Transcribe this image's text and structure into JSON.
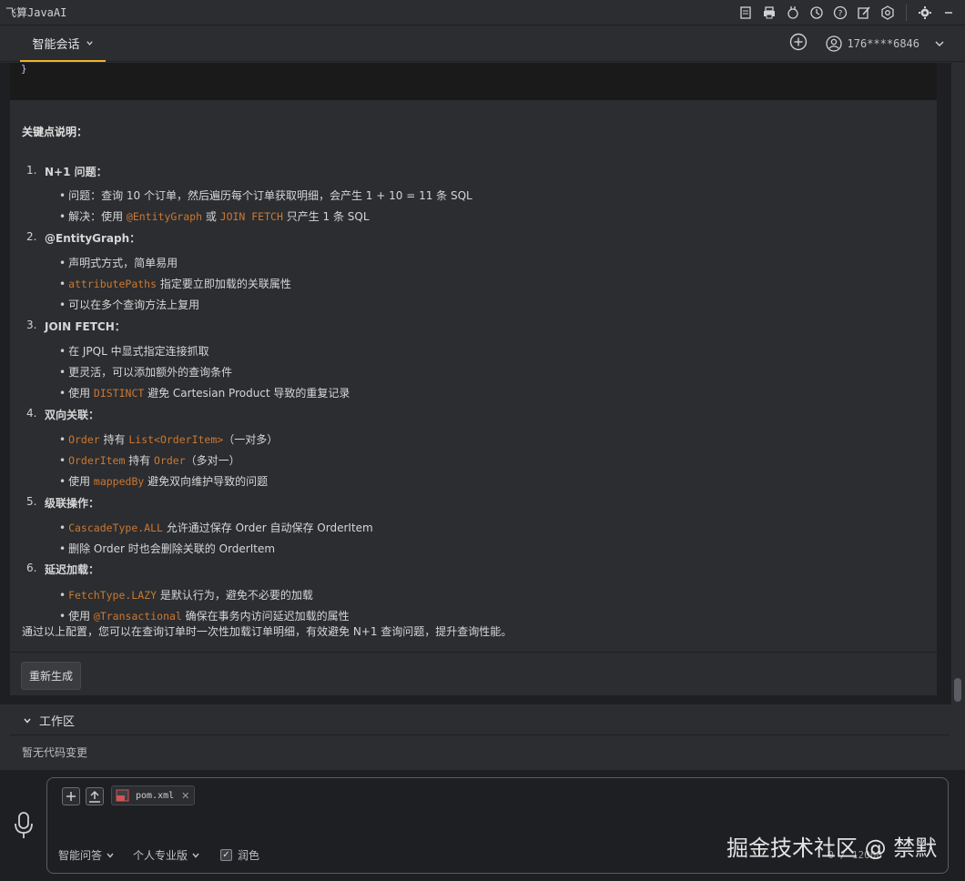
{
  "app": {
    "title": "飞算JavaAI"
  },
  "header": {
    "tab_label": "智能会话",
    "user_label": "176****6846"
  },
  "code_tail": "}",
  "answer": {
    "title": "关键点说明：",
    "sections": [
      {
        "num": "1.",
        "title": "N+1 问题：",
        "items": [
          {
            "parts": [
              {
                "t": "问题：查询 10 个订单，然后遍历每个订单获取明细，会产生 1 + 10 = 11 条 SQL"
              }
            ]
          },
          {
            "parts": [
              {
                "t": "解决：使用 "
              },
              {
                "c": "@EntityGraph"
              },
              {
                "t": " 或 "
              },
              {
                "c": "JOIN FETCH"
              },
              {
                "t": " 只产生 1 条 SQL"
              }
            ]
          }
        ]
      },
      {
        "num": "2.",
        "title": "@EntityGraph：",
        "items": [
          {
            "parts": [
              {
                "t": "声明式方式，简单易用"
              }
            ]
          },
          {
            "parts": [
              {
                "c": "attributePaths"
              },
              {
                "t": " 指定要立即加载的关联属性"
              }
            ]
          },
          {
            "parts": [
              {
                "t": "可以在多个查询方法上复用"
              }
            ]
          }
        ]
      },
      {
        "num": "3.",
        "title": "JOIN FETCH：",
        "items": [
          {
            "parts": [
              {
                "t": "在 JPQL 中显式指定连接抓取"
              }
            ]
          },
          {
            "parts": [
              {
                "t": "更灵活，可以添加额外的查询条件"
              }
            ]
          },
          {
            "parts": [
              {
                "t": "使用 "
              },
              {
                "c": "DISTINCT"
              },
              {
                "t": " 避免 Cartesian Product 导致的重复记录"
              }
            ]
          }
        ]
      },
      {
        "num": "4.",
        "title": "双向关联：",
        "items": [
          {
            "parts": [
              {
                "c": "Order"
              },
              {
                "t": " 持有 "
              },
              {
                "c": "List<OrderItem>"
              },
              {
                "t": "（一对多）"
              }
            ]
          },
          {
            "parts": [
              {
                "c": "OrderItem"
              },
              {
                "t": " 持有 "
              },
              {
                "c": "Order"
              },
              {
                "t": "（多对一）"
              }
            ]
          },
          {
            "parts": [
              {
                "t": "使用 "
              },
              {
                "c": "mappedBy"
              },
              {
                "t": " 避免双向维护导致的问题"
              }
            ]
          }
        ]
      },
      {
        "num": "5.",
        "title": "级联操作：",
        "items": [
          {
            "parts": [
              {
                "c": "CascadeType.ALL"
              },
              {
                "t": " 允许通过保存 Order 自动保存 OrderItem"
              }
            ]
          },
          {
            "parts": [
              {
                "t": "删除 Order 时也会删除关联的 OrderItem"
              }
            ]
          }
        ]
      },
      {
        "num": "6.",
        "title": "延迟加载：",
        "items": [
          {
            "parts": [
              {
                "c": "FetchType.LAZY"
              },
              {
                "t": " 是默认行为，避免不必要的加载"
              }
            ]
          },
          {
            "parts": [
              {
                "t": "使用 "
              },
              {
                "c": "@Transactional"
              },
              {
                "t": " 确保在事务内访问延迟加载的属性"
              }
            ]
          }
        ]
      }
    ],
    "conclusion": "通过以上配置，您可以在查询订单时一次性加载订单明细，有效避免 N+1 查询问题，提升查询性能。",
    "regen_label": "重新生成"
  },
  "workspace": {
    "title": "工作区",
    "empty_text": "暂无代码变更"
  },
  "input": {
    "attachment": "pom.xml",
    "mode": "智能问答",
    "edition": "个人专业版",
    "polish_label": "润色",
    "polish_checked": true,
    "counter": "0 / 12000"
  },
  "watermark": "掘金技术社区 @ 禁默",
  "colors": {
    "code": "#cc7832",
    "accent_tab": "#f0b429"
  }
}
